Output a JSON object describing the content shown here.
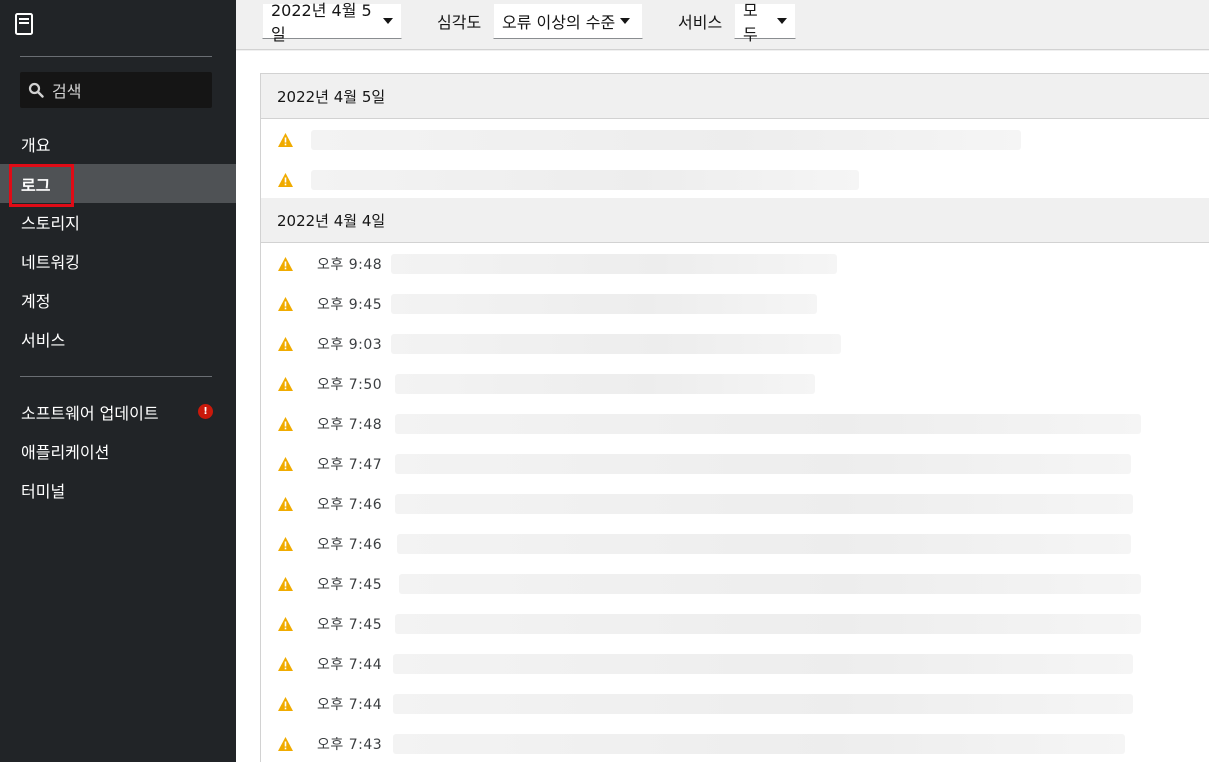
{
  "sidebar": {
    "search_label": "검색",
    "nav_items": [
      "개요",
      "로그",
      "스토리지",
      "네트워킹",
      "계정",
      "서비스"
    ],
    "nav_items2": [
      "소프트웨어 업데이트",
      "애플리케이션",
      "터미널"
    ],
    "update_alert": "!"
  },
  "toolbar": {
    "date_value": "2022년 4월 5일",
    "severity_label": "심각도",
    "severity_value": "오류 이상의 수준",
    "service_label": "서비스",
    "service_value": "모두"
  },
  "days": [
    {
      "label": "2022년 4월 5일",
      "entries": [
        {
          "time": ""
        },
        {
          "time": ""
        }
      ]
    },
    {
      "label": "2022년 4월 4일",
      "entries": [
        {
          "time": "오후 9:48"
        },
        {
          "time": "오후 9:45"
        },
        {
          "time": "오후 9:03"
        },
        {
          "time": "오후 7:50"
        },
        {
          "time": "오후 7:48"
        },
        {
          "time": "오후 7:47"
        },
        {
          "time": "오후 7:46"
        },
        {
          "time": "오후 7:46"
        },
        {
          "time": "오후 7:45"
        },
        {
          "time": "오후 7:45"
        },
        {
          "time": "오후 7:44"
        },
        {
          "time": "오후 7:44"
        },
        {
          "time": "오후 7:43"
        }
      ]
    }
  ],
  "colors": {
    "sidebar_bg": "#212427",
    "active_bg": "#4f5255",
    "highlight": "#e00b16",
    "warning": "#f0ab00",
    "alert": "#c9190b"
  }
}
